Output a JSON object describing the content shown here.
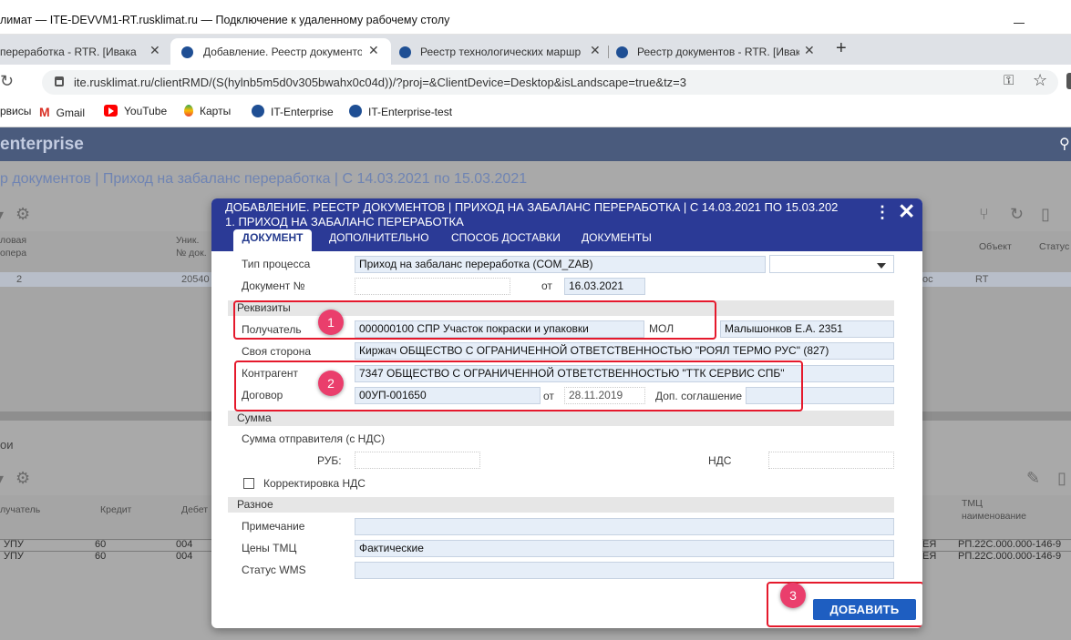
{
  "window": {
    "title": "лимат — ITE-DEVVM1-RT.rusklimat.ru — Подключение к удаленному рабочему столу"
  },
  "browser": {
    "tabs": [
      {
        "label": "переработка - RTR. [Ивакаева Н",
        "active": false
      },
      {
        "label": "Добавление. Реестр документов",
        "active": true
      },
      {
        "label": "Реестр технологических маршр",
        "active": false
      },
      {
        "label": "Реестр документов - RTR. [Ивак",
        "active": false
      }
    ],
    "new_tab": "+",
    "url": "ite.rusklimat.ru/clientRMD/(S(hylnb5m5d0v305bwahx0c04d))/?proj=&ClientDevice=Desktop&isLandscape=true&tz=3",
    "bookmarks": [
      "рвисы",
      "Gmail",
      "YouTube",
      "Карты",
      "IT-Enterprise",
      "IT-Enterprise-test"
    ]
  },
  "app": {
    "logo": "enterprise",
    "page_title": "р документов | Приход на забаланс переработка | С 14.03.2021 по 15.03.2021",
    "grid_top": {
      "headers": [
        "ловая\nопера",
        "Уник.\n№ док.",
        "Объект",
        "Статус"
      ],
      "row": [
        "2",
        "20540",
        "ос",
        "RT"
      ]
    },
    "lower_label": "ои",
    "grid_bottom": {
      "headers": [
        "лучатель",
        "Кредит",
        "Дебет",
        "ТМЦ\nнаименование"
      ],
      "rows": [
        [
          "УПУ",
          "60",
          "004",
          "ЕЯ",
          "РП.22С.000.000-146-9"
        ],
        [
          "УПУ",
          "60",
          "004",
          "ЕЯ",
          "РП.22С.000.000-146-9"
        ]
      ]
    }
  },
  "dialog": {
    "title": "ДОБАВЛЕНИЕ. РЕЕСТР ДОКУМЕНТОВ | ПРИХОД НА ЗАБАЛАНС ПЕРЕРАБОТКА | С 14.03.2021 ПО 15.03.202\n1. ПРИХОД НА ЗАБАЛАНС ПЕРЕРАБОТКА",
    "tabs": [
      "ДОКУМЕНТ",
      "ДОПОЛНИТЕЛЬНО",
      "СПОСОБ ДОСТАВКИ",
      "ДОКУМЕНТЫ"
    ],
    "process_type_label": "Тип процесса",
    "process_type_value": "Приход на забаланс переработка (COM_ZAB)",
    "doc_no_label": "Документ №",
    "from_label": "от",
    "doc_date": "16.03.2021",
    "section_requisites": "Реквизиты",
    "recipient_label": "Получатель",
    "recipient_value": "000000100 СПР Участок покраски и упаковки",
    "mol_label": "МОЛ",
    "mol_value": "Малышонков Е.А.    2351",
    "own_side_label": "Своя сторона",
    "own_side_value": "Киржач ОБЩЕСТВО С ОГРАНИЧЕННОЙ ОТВЕТСТВЕННОСТЬЮ \"РОЯЛ ТЕРМО РУС\" (827)",
    "counterparty_label": "Контрагент",
    "counterparty_value": "7347 ОБЩЕСТВО С ОГРАНИЧЕННОЙ ОТВЕТСТВЕННОСТЬЮ \"ТТК СЕРВИС СПБ\"",
    "contract_label": "Договор",
    "contract_value": "00УП-001650",
    "contract_from_label": "от",
    "contract_date": "28.11.2019",
    "addendum_label": "Доп. соглашение",
    "section_sum": "Сумма",
    "sender_sum_label": "Сумма отправителя (с НДС)",
    "rub_label": "РУБ:",
    "vat_label": "НДС",
    "vat_correction_label": "Корректировка НДС",
    "section_misc": "Разное",
    "note_label": "Примечание",
    "prices_label": "Цены ТМЦ",
    "prices_value": "Фактические",
    "wms_label": "Статус WMS",
    "add_button": "ДОБАВИТЬ"
  },
  "annotations": [
    "1",
    "2",
    "3"
  ],
  "colors": {
    "app_header": "#4a5b7d",
    "dialog_header": "#2b3a96",
    "add_button": "#1e5ec1",
    "highlight_box": "#e5192c",
    "badge": "#ea3e6c"
  }
}
